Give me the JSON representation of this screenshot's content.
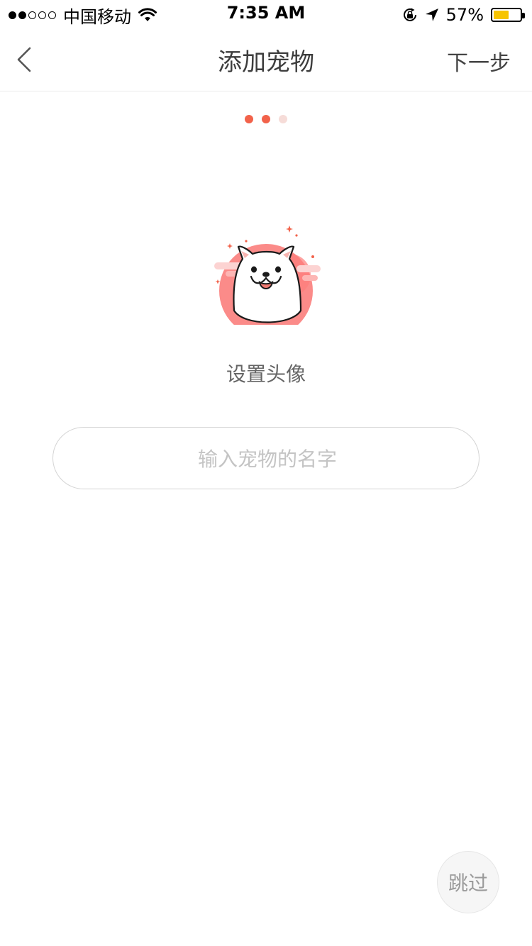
{
  "status_bar": {
    "signal": [
      "filled",
      "filled",
      "empty",
      "empty",
      "empty"
    ],
    "carrier": "中国移动",
    "time": "7:35 AM",
    "battery_percent": "57%",
    "battery_level": 0.57,
    "icons": [
      "wifi-icon",
      "rotation-lock-icon",
      "location-arrow-icon",
      "battery-icon"
    ]
  },
  "nav": {
    "title": "添加宠物",
    "next_label": "下一步",
    "back_icon": "chevron-left-icon"
  },
  "steps": {
    "total": 3,
    "current": 2,
    "active_color": "#f2624a",
    "inactive_color": "#f6dcd8"
  },
  "avatar": {
    "icon": "dog-avatar-icon",
    "label": "设置头像"
  },
  "name_input": {
    "placeholder": "输入宠物的名字",
    "value": ""
  },
  "skip": {
    "label": "跳过"
  },
  "colors": {
    "accent": "#f2624a",
    "avatar_bg": "#fb8b89"
  }
}
